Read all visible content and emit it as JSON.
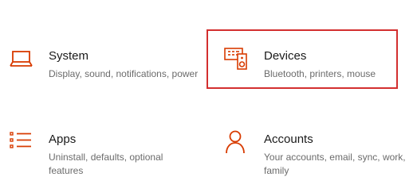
{
  "accent_color": "#d83b01",
  "highlight_color": "#d32f2f",
  "tiles": [
    {
      "title": "System",
      "description": "Display, sound, notifications, power",
      "icon": "laptop-icon"
    },
    {
      "title": "Devices",
      "description": "Bluetooth, printers, mouse",
      "icon": "keyboard-speaker-icon",
      "selected": true
    },
    {
      "title": "Apps",
      "description": "Uninstall, defaults, optional features",
      "icon": "apps-list-icon"
    },
    {
      "title": "Accounts",
      "description": "Your accounts, email, sync, work, family",
      "icon": "person-icon"
    }
  ]
}
